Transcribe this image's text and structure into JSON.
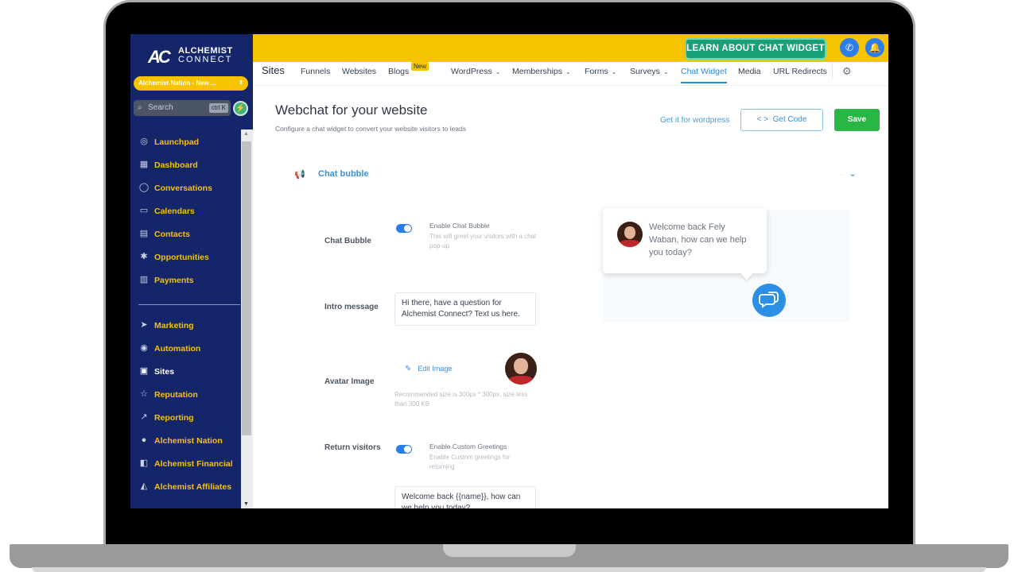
{
  "brand": {
    "mark": "AC",
    "line1": "ALCHEMIST",
    "line2": "CONNECT"
  },
  "account": {
    "name": "Alchemist Nation - New ..."
  },
  "search": {
    "placeholder": "Search",
    "shortcut": "ctrl K"
  },
  "sidebar": {
    "items": [
      {
        "label": "Launchpad",
        "icon": "rocket-icon",
        "glyph": "◎"
      },
      {
        "label": "Dashboard",
        "icon": "dashboard-icon",
        "glyph": "▦"
      },
      {
        "label": "Conversations",
        "icon": "chat-icon",
        "glyph": "◯"
      },
      {
        "label": "Calendars",
        "icon": "calendar-icon",
        "glyph": "▭"
      },
      {
        "label": "Contacts",
        "icon": "contacts-icon",
        "glyph": "▤"
      },
      {
        "label": "Opportunities",
        "icon": "opportunities-icon",
        "glyph": "✱"
      },
      {
        "label": "Payments",
        "icon": "payments-icon",
        "glyph": "▥"
      },
      {
        "label": "Marketing",
        "icon": "send-icon",
        "glyph": "➤"
      },
      {
        "label": "Automation",
        "icon": "automation-icon",
        "glyph": "◉"
      },
      {
        "label": "Sites",
        "icon": "sites-icon",
        "glyph": "▣"
      },
      {
        "label": "Reputation",
        "icon": "star-icon",
        "glyph": "☆"
      },
      {
        "label": "Reporting",
        "icon": "chart-icon",
        "glyph": "↗"
      },
      {
        "label": "Alchemist Nation",
        "icon": "group-icon",
        "glyph": "●"
      },
      {
        "label": "Alchemist Financial",
        "icon": "coins-icon",
        "glyph": "◧"
      },
      {
        "label": "Alchemist Affiliates",
        "icon": "affiliate-icon",
        "glyph": "◭"
      }
    ]
  },
  "topbar": {
    "learn_label": "LEARN ABOUT CHAT WIDGET"
  },
  "subnav": {
    "title": "Sites",
    "tabs": [
      "Funnels",
      "Websites",
      "Blogs",
      "WordPress",
      "Memberships",
      "Forms",
      "Surveys",
      "Chat Widget",
      "Media",
      "URL Redirects"
    ],
    "new_badge": "New",
    "active": "Chat Widget"
  },
  "page": {
    "title": "Webchat for your website",
    "subtitle": "Configure a chat widget to convert your website visitors to leads",
    "wp_link": "Get it for wordpress",
    "get_code": "Get Code",
    "save": "Save"
  },
  "section": {
    "title": "Chat bubble"
  },
  "form": {
    "chat_bubble_label": "Chat Bubble",
    "enable_bubble_title": "Enable Chat Bubble",
    "enable_bubble_desc": "This will greet your visitors with a chat pop-up",
    "chat_bubble_enabled": true,
    "intro_label": "Intro message",
    "intro_value": "Hi there, have a question for Alchemist Connect? Text us here.",
    "avatar_label": "Avatar Image",
    "edit_image": "Edit Image",
    "image_hint": "Recommended size is 300px * 300px, size less than 300 KB",
    "return_label": "Return visitors",
    "custom_greet_title": "Enable Custom Greetings",
    "custom_greet_desc": "Enable Custom greetings for returning",
    "custom_greet_enabled": true,
    "return_value": "Welcome back {{name}}, how can we help you today?"
  },
  "preview": {
    "message": "Welcome back Fely Waban, how can we help you today?"
  },
  "colors": {
    "sidebar": "#14256a",
    "accent": "#f6c300",
    "primary": "#2b7de9",
    "save": "#2ab644"
  }
}
